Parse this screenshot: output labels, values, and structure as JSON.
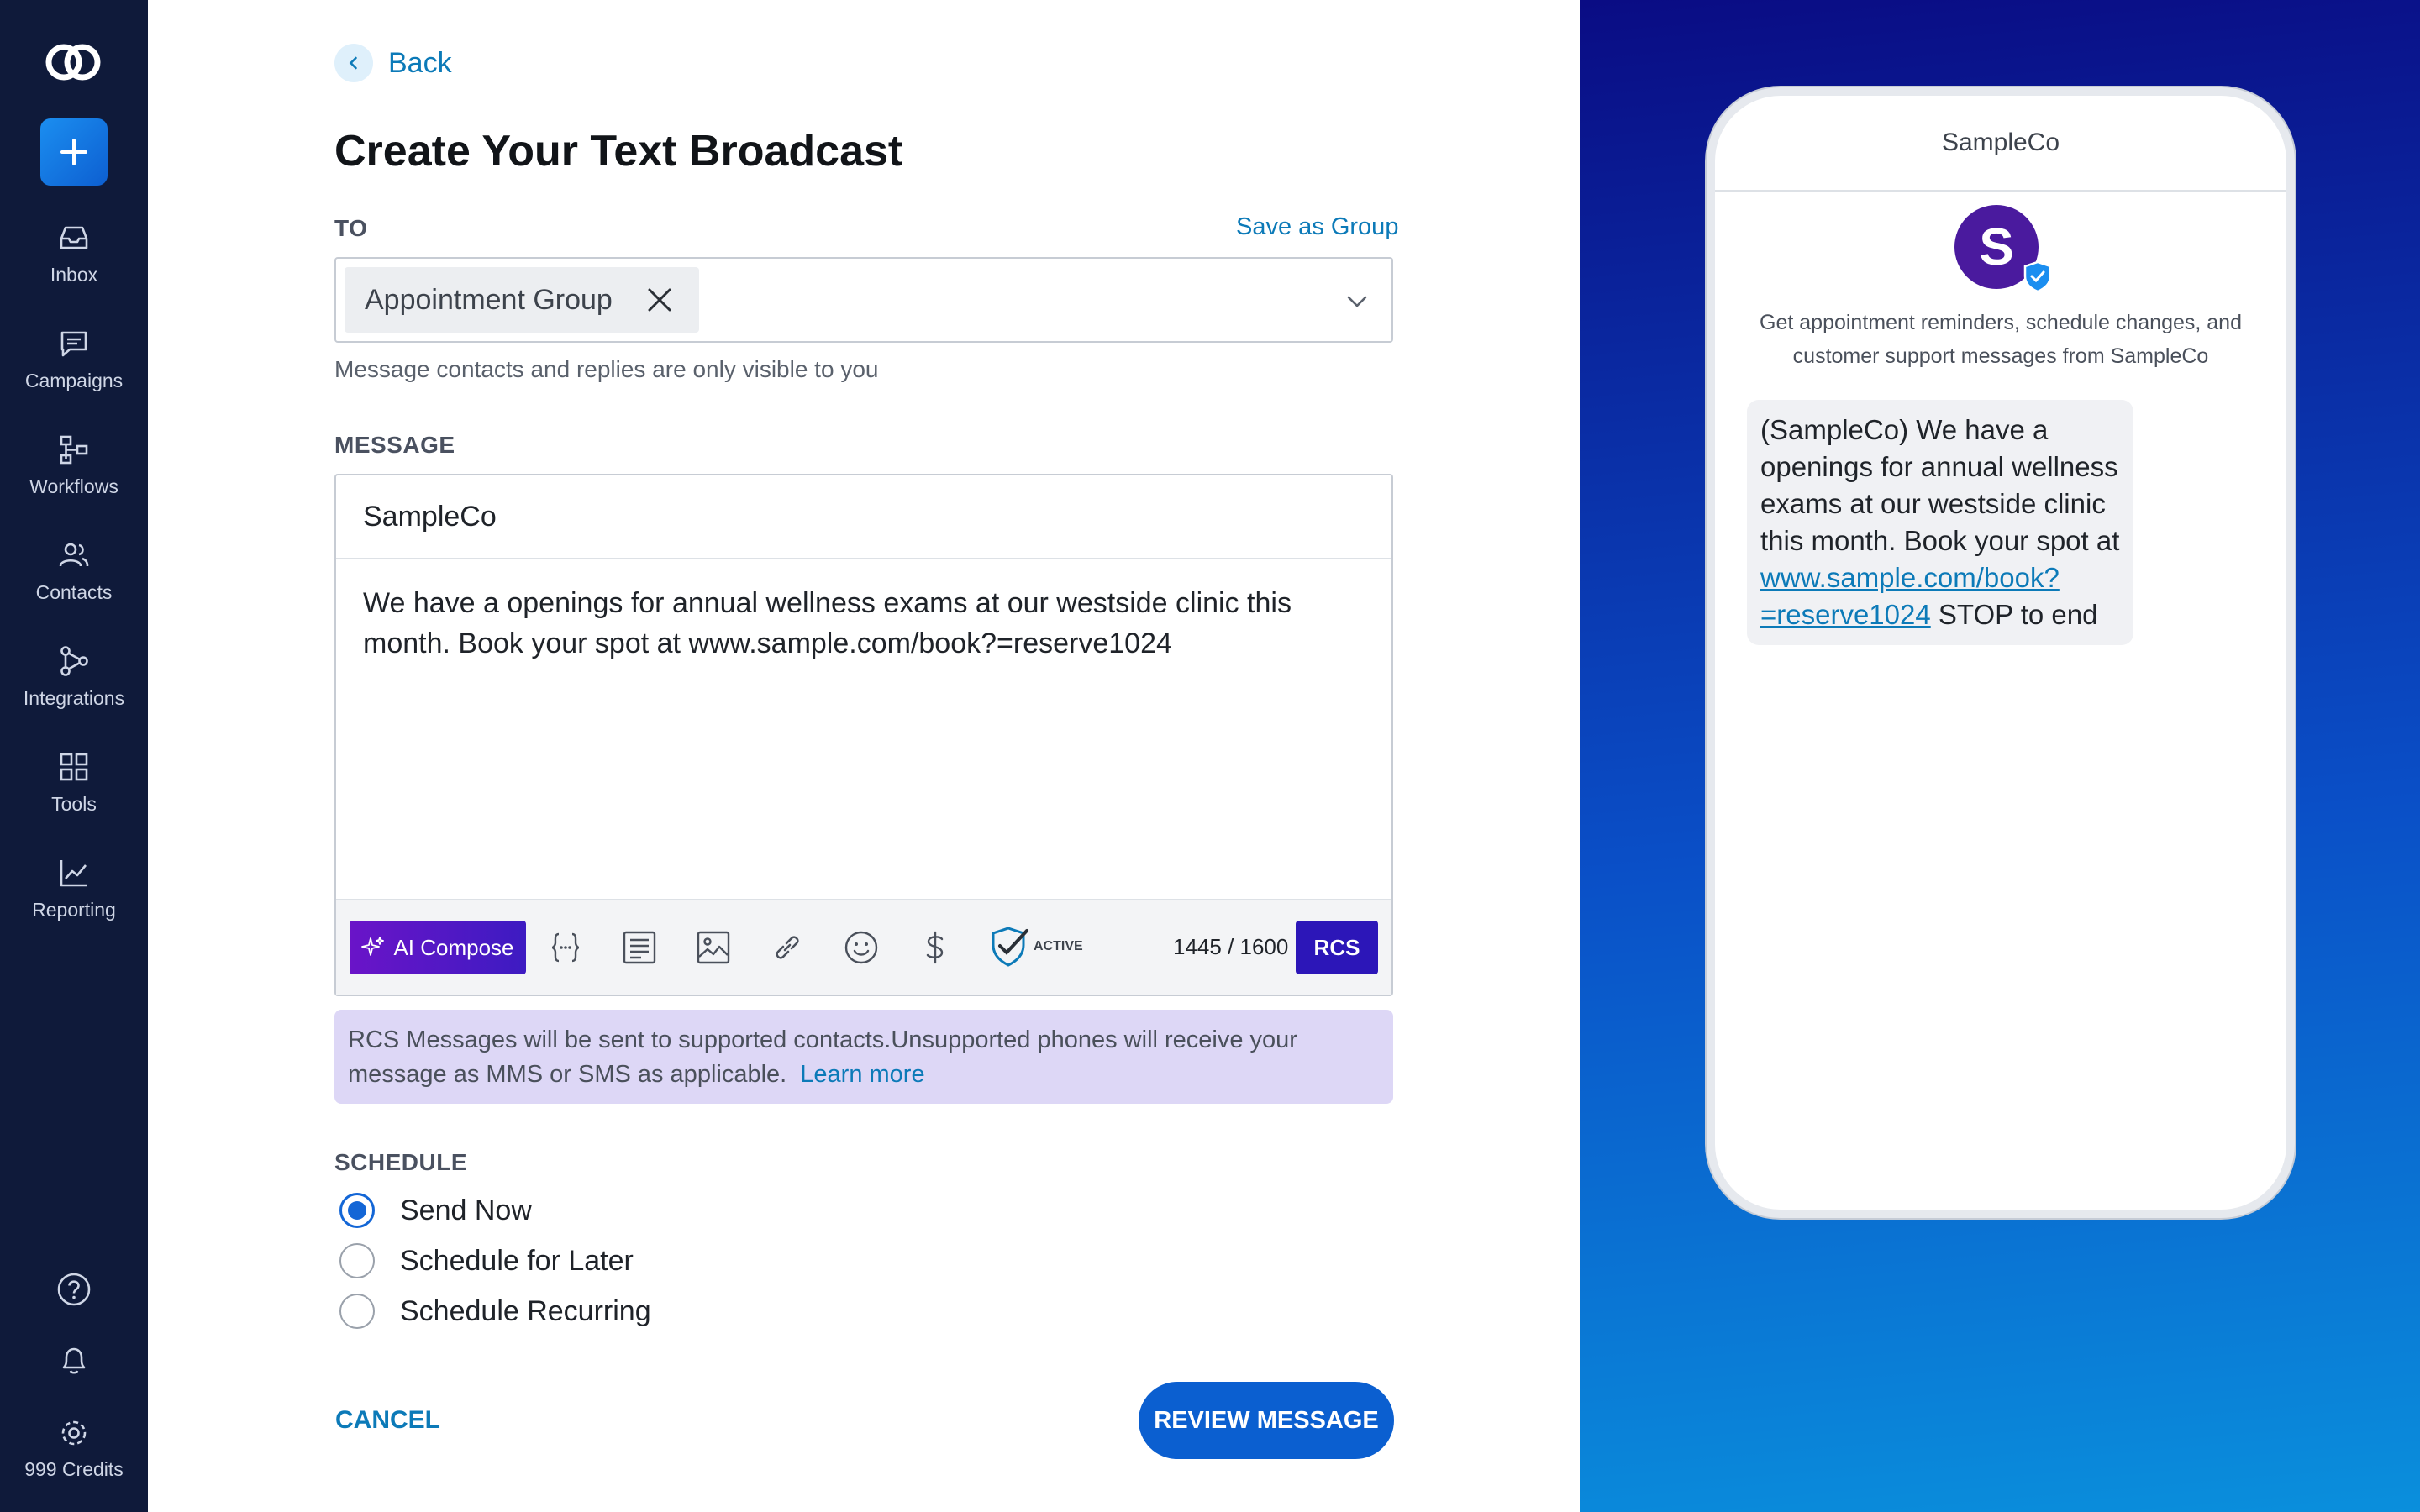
{
  "sidebar": {
    "items": [
      {
        "label": "Inbox",
        "icon": "inbox-icon"
      },
      {
        "label": "Campaigns",
        "icon": "chat-icon"
      },
      {
        "label": "Workflows",
        "icon": "workflow-icon"
      },
      {
        "label": "Contacts",
        "icon": "contacts-icon"
      },
      {
        "label": "Integrations",
        "icon": "integrations-icon"
      },
      {
        "label": "Tools",
        "icon": "grid-icon"
      },
      {
        "label": "Reporting",
        "icon": "chart-icon"
      }
    ],
    "credits": "999 Credits"
  },
  "form": {
    "back": "Back",
    "title": "Create Your Text Broadcast",
    "to_label": "TO",
    "save_group": "Save as Group",
    "recipient_chip": "Appointment Group",
    "helper": "Message contacts and replies are only visible to you",
    "message_label": "MESSAGE",
    "sender": "SampleCo",
    "message_text": "We have a openings for annual wellness exams at our westside clinic this month. Book your spot at www.sample.com/book?=reserve1024",
    "ai_compose": "AI Compose",
    "active_label": "ACTIVE",
    "counter": "1445 / 1600",
    "rcs": "RCS",
    "rcs_note": "RCS Messages will be sent to supported contacts.Unsupported phones will receive your message as MMS or SMS as applicable.",
    "learn_more": "Learn more",
    "schedule_label": "SCHEDULE",
    "schedule_options": [
      "Send Now",
      "Schedule for Later",
      "Schedule Recurring"
    ],
    "cancel": "CANCEL",
    "review": "REVIEW MESSAGE"
  },
  "preview": {
    "header": "SampleCo",
    "avatar_letter": "S",
    "description": "Get appointment reminders, schedule changes, and customer support messages from SampleCo",
    "bubble_text": "(SampleCo) We have a openings for annual wellness exams at our westside clinic this month. Book your spot at",
    "bubble_link": "www.sample.com/book?=reserve1024",
    "bubble_suffix": "STOP to end"
  },
  "colors": {
    "sidebar_bg": "#0f1a3a",
    "accent": "#0c7ab8",
    "primary_button": "#0b5fd0",
    "rcs_button": "#2c16b8",
    "rcs_note_bg": "#ddd7f6"
  }
}
